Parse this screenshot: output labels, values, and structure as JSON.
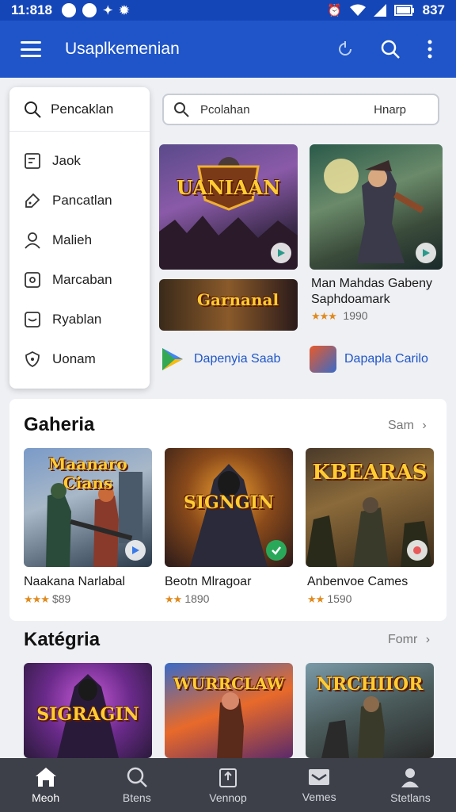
{
  "status_bar": {
    "time": "11:818",
    "battery": "837"
  },
  "app_bar": {
    "title": "Usaplkemenian"
  },
  "search": {
    "text": "Pcolahan",
    "hint": "Hnarp"
  },
  "drawer": {
    "search_label": "Pencaklan",
    "items": [
      {
        "label": "Jaok",
        "icon": "bookmark-icon"
      },
      {
        "label": "Pancatlan",
        "icon": "tag-icon"
      },
      {
        "label": "Malieh",
        "icon": "person-icon"
      },
      {
        "label": "Marcaban",
        "icon": "image-icon"
      },
      {
        "label": "Ryablan",
        "icon": "mail-icon"
      },
      {
        "label": "Uonam",
        "icon": "shield-icon"
      }
    ]
  },
  "featured": {
    "img1_title": "UANIAAN",
    "img2_title": "",
    "banner_title": "Garnanal",
    "side_title_line1": "Man Mahdas Gabeny",
    "side_title_line2": "Saphdoamark",
    "side_rating": "1990",
    "app_link_1": "Dapenyia Saab",
    "app_link_2": "Dapapla Carilo"
  },
  "section_games": {
    "title": "Gaheria",
    "more": "Sam",
    "items": [
      {
        "image_title": "Maanaro Cians",
        "name": "Naakana Narlabal",
        "rating": "$89"
      },
      {
        "image_title": "SIGNGIN",
        "name": "Beotn Mlragoar",
        "rating": "1890"
      },
      {
        "image_title": "KBEARAS",
        "name": "Anbenvoe Cames",
        "rating": "1590"
      }
    ]
  },
  "section_category": {
    "title": "Katégria",
    "more": "Fomr",
    "items": [
      {
        "image_title": "SIGRAGIN"
      },
      {
        "image_title": "WURRCLAW"
      },
      {
        "image_title": "NRCHIIOR"
      }
    ]
  },
  "bottom_nav": [
    {
      "label": "Meoh",
      "icon": "home-icon",
      "active": true
    },
    {
      "label": "Btens",
      "icon": "search-icon",
      "active": false
    },
    {
      "label": "Vennop",
      "icon": "upload-icon",
      "active": false
    },
    {
      "label": "Vemes",
      "icon": "inbox-icon",
      "active": false
    },
    {
      "label": "Stetlans",
      "icon": "profile-icon",
      "active": false
    }
  ],
  "colors": {
    "primary": "#1f55c8",
    "status_bar": "#1546b8",
    "nav_bg": "#3d4049",
    "star": "#e08a1e"
  }
}
